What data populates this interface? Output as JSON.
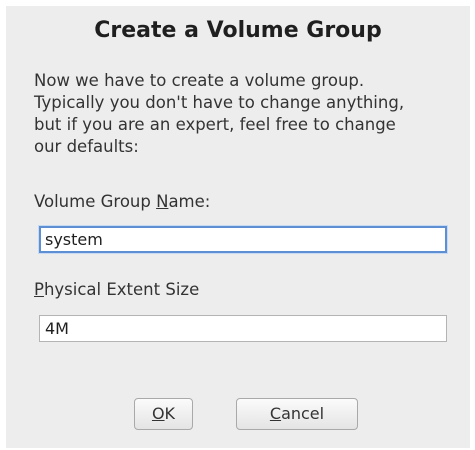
{
  "dialog": {
    "title": "Create a Volume Group",
    "description_lines": [
      "Now we have to create a volume group.",
      "Typically you don't have to change anything,",
      "but if you are an expert, feel free to change",
      "our defaults:"
    ],
    "vg_name_label_pre": "Volume Group ",
    "vg_name_label_mnemonic": "N",
    "vg_name_label_post": "ame:",
    "vg_name_value": "system",
    "extent_label_mnemonic": "P",
    "extent_label_post": "hysical Extent Size",
    "extent_value": "4M",
    "ok_mnemonic": "O",
    "ok_post": "K",
    "cancel_mnemonic": "C",
    "cancel_post": "ancel"
  }
}
